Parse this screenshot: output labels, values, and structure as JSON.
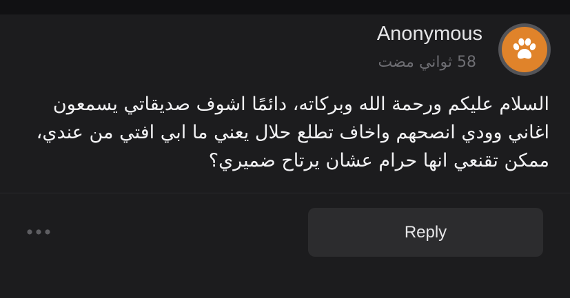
{
  "colors": {
    "background": "#1c1c1e",
    "top_bar": "#111113",
    "avatar_bg": "#e0832a",
    "avatar_ring": "#545458",
    "username": "#e6e6e8",
    "timestamp": "#6e6e73",
    "message": "#f2f2f4",
    "button_bg": "#2c2c2e"
  },
  "post": {
    "avatar_icon": "paw-icon",
    "author": "Anonymous",
    "timestamp": "58 ثواني مضت",
    "message": "السلام عليكم ورحمة الله وبركاته، دائمًا اشوف صديقاتي يسمعون اغاني وودي انصحهم واخاف تطلع حلال يعني ما ابي افتي من عندي، ممكن تقنعي انها حرام عشان يرتاح ضميري؟"
  },
  "actions": {
    "more_icon": "more-dots-icon",
    "reply_label": "Reply"
  }
}
